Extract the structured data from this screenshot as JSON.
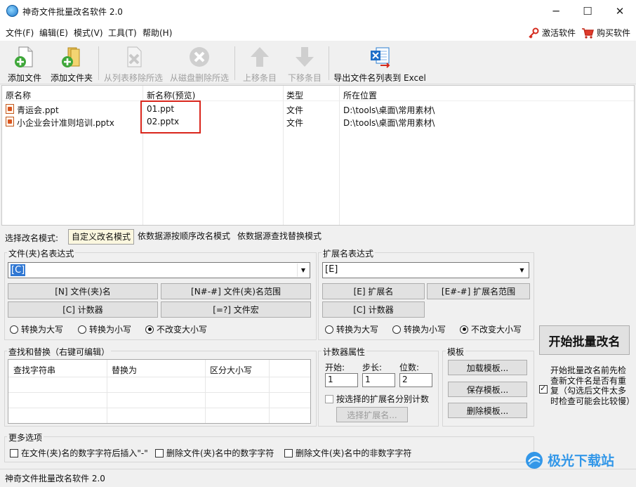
{
  "window": {
    "title": "神奇文件批量改名软件 2.0",
    "minimize": "─",
    "maximize": "☐",
    "close": "✕"
  },
  "menu": {
    "items": [
      "文件(F)",
      "编辑(E)",
      "模式(V)",
      "工具(T)",
      "帮助(H)"
    ],
    "activate": "激活软件",
    "buy": "购买软件"
  },
  "toolbar": {
    "add_file": "添加文件",
    "add_folder": "添加文件夹",
    "remove_from_list": "从列表移除所选",
    "delete_from_disk": "从磁盘删除所选",
    "move_up": "上移条目",
    "move_down": "下移条目",
    "export_excel": "导出文件名列表到 Excel"
  },
  "file_list": {
    "headers": {
      "original": "原名称",
      "new": "新名称(预览)",
      "type": "类型",
      "location": "所在位置"
    },
    "rows": [
      {
        "original": "青运会.ppt",
        "new": "01.ppt",
        "type": "文件",
        "location": "D:\\tools\\桌面\\常用素材\\"
      },
      {
        "original": "小企业会计准则培训.pptx",
        "new": "02.pptx",
        "type": "文件",
        "location": "D:\\tools\\桌面\\常用素材\\"
      }
    ]
  },
  "modes": {
    "label": "选择改名模式:",
    "custom": "自定义改名模式",
    "sequence": "依数据源按顺序改名模式",
    "replace": "依数据源查找替换模式"
  },
  "name_expr": {
    "title": "文件(夹)名表达式",
    "value": "[C]",
    "btn_name": "[N] 文件(夹)名",
    "btn_range": "[N#-#] 文件(夹)名范围",
    "btn_counter": "[C] 计数器",
    "btn_macro": "[=?] 文件宏",
    "upper": "转换为大写",
    "lower": "转换为小写",
    "keep": "不改变大小写"
  },
  "ext_expr": {
    "title": "扩展名表达式",
    "value": "[E]",
    "btn_ext": "[E] 扩展名",
    "btn_range": "[E#-#] 扩展名范围",
    "btn_counter": "[C] 计数器",
    "upper": "转换为大写",
    "lower": "转换为小写",
    "keep": "不改变大小写"
  },
  "find_replace": {
    "title": "查找和替换（右键可编辑）",
    "col_find": "查找字符串",
    "col_replace": "替换为",
    "col_case": "区分大小写"
  },
  "counter": {
    "title": "计数器属性",
    "start_label": "开始:",
    "step_label": "步长:",
    "digits_label": "位数:",
    "start": "1",
    "step": "1",
    "digits": "2",
    "per_ext": "按选择的扩展名分别计数",
    "choose_ext": "选择扩展名..."
  },
  "template": {
    "title": "模板",
    "load": "加载模板...",
    "save": "保存模板...",
    "delete": "删除模板..."
  },
  "start_button": "开始批量改名",
  "check_option": "开始批量改名前先检查新文件名是否有重复（勾选后文件太多时检查可能会比较慢）",
  "more": {
    "title": "更多选项",
    "opt1": "在文件(夹)名的数字字符后插入\"-\"",
    "opt2": "删除文件(夹)名中的数字字符",
    "opt3": "删除文件(夹)名中的非数字字符"
  },
  "status": "神奇文件批量改名软件 2.0",
  "watermark": "极光下载站",
  "colors": {
    "highlight_box": "#d9261c",
    "mode_active_bg": "#fbf7df"
  }
}
